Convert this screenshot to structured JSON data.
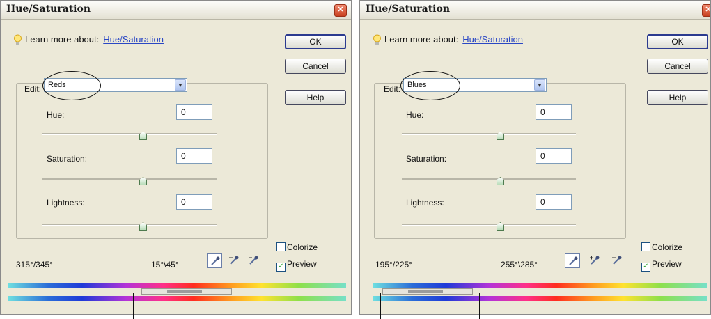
{
  "dialogs": [
    {
      "title": "Hue/Saturation",
      "learn_more_text": "Learn more about:",
      "learn_more_link": "Hue/Saturation",
      "buttons": {
        "ok": "OK",
        "cancel": "Cancel",
        "help": "Help"
      },
      "edit_label": "Edit:",
      "edit_value": "Reds",
      "hue_label": "Hue:",
      "hue_value": "0",
      "saturation_label": "Saturation:",
      "saturation_value": "0",
      "lightness_label": "Lightness:",
      "lightness_value": "0",
      "range_left": "315°/345°",
      "range_right": "15°\\45°",
      "colorize_label": "Colorize",
      "colorize_checked": false,
      "preview_label": "Preview",
      "preview_checked": true
    },
    {
      "title": "Hue/Saturation",
      "learn_more_text": "Learn more about:",
      "learn_more_link": "Hue/Saturation",
      "buttons": {
        "ok": "OK",
        "cancel": "Cancel",
        "help": "Help"
      },
      "edit_label": "Edit:",
      "edit_value": "Blues",
      "hue_label": "Hue:",
      "hue_value": "0",
      "saturation_label": "Saturation:",
      "saturation_value": "0",
      "lightness_label": "Lightness:",
      "lightness_value": "0",
      "range_left": "195°/225°",
      "range_right": "255°\\285°",
      "colorize_label": "Colorize",
      "colorize_checked": false,
      "preview_label": "Preview",
      "preview_checked": true
    }
  ],
  "icons": {
    "bulb": "lightbulb-icon",
    "close": "close-icon",
    "eyedropper": "eyedropper-icon",
    "eyedropper_add": "eyedropper-plus-icon",
    "eyedropper_subtract": "eyedropper-minus-icon"
  },
  "colors": {
    "dialog_bg": "#ece9d8",
    "link": "#2a47c4",
    "slider_thumb": "#b9dcb9"
  }
}
